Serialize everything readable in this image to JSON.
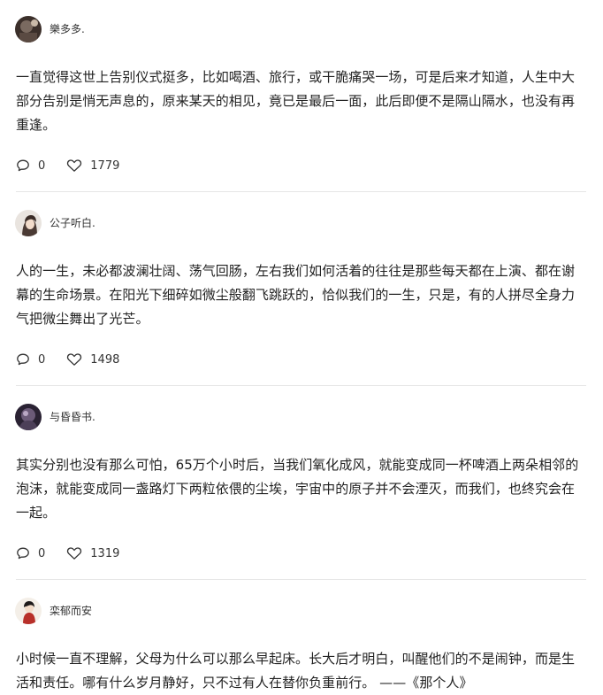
{
  "posts": [
    {
      "username": "樂多多.",
      "avatar": "avatar-image",
      "text": "一直觉得这世上告别仪式挺多，比如喝酒、旅行，或干脆痛哭一场，可是后来才知道，人生中大部分告别是悄无声息的，原来某天的相见，竟已是最后一面，此后即便不是隔山隔水，也没有再重逢。",
      "comments": "0",
      "likes": "1779"
    },
    {
      "username": "公子听白.",
      "avatar": "avatar-image",
      "text": "人的一生，未必都波澜壮阔、荡气回肠，左右我们如何活着的往往是那些每天都在上演、都在谢幕的生命场景。在阳光下细碎如微尘般翻飞跳跃的，恰似我们的一生，只是，有的人拼尽全身力气把微尘舞出了光芒。",
      "comments": "0",
      "likes": "1498"
    },
    {
      "username": "与昏昏书.",
      "avatar": "avatar-image",
      "text": "其实分别也没有那么可怕，65万个小时后，当我们氧化成风，就能变成同一杯啤酒上两朵相邻的泡沫，就能变成同一盏路灯下两粒依偎的尘埃，宇宙中的原子并不会湮灭，而我们，也终究会在一起。",
      "comments": "0",
      "likes": "1319"
    },
    {
      "username": "栾郁而安",
      "avatar": "avatar-image",
      "text": "小时候一直不理解，父母为什么可以那么早起床。长大后才明白，叫醒他们的不是闹钟，而是生活和责任。哪有什么岁月静好，只不过有人在替你负重前行。 ——《那个人》"
    }
  ],
  "icons": {
    "comment": "comment-icon",
    "like": "heart-icon"
  },
  "colors": {
    "text": "#222222",
    "divider": "#e6e6e6",
    "icon": "#333333"
  }
}
